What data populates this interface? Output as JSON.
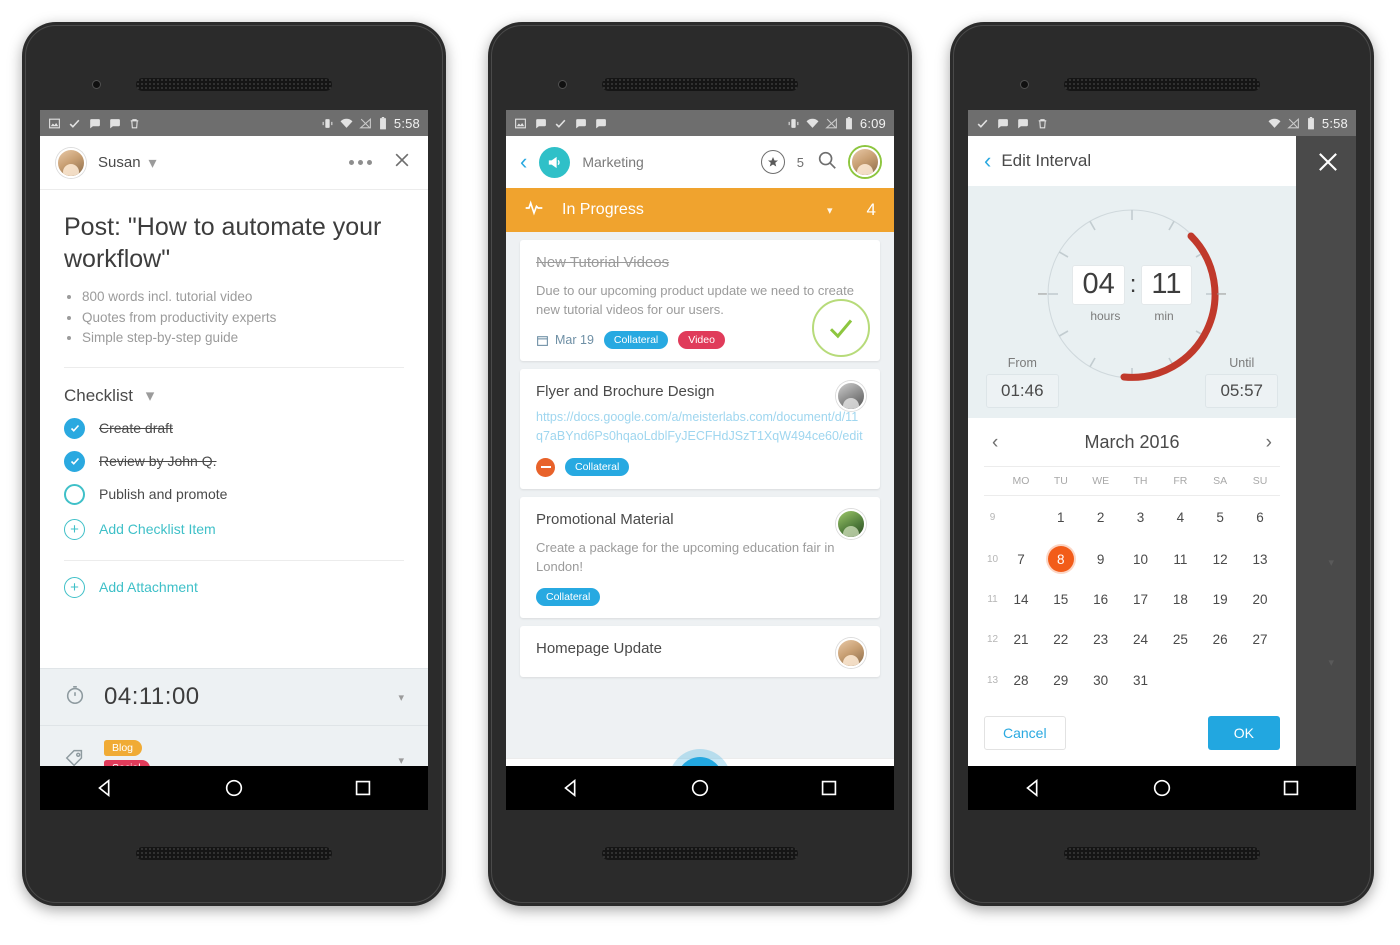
{
  "phone1": {
    "statusbar": {
      "time": "5:58",
      "left_icons": [
        "image-icon",
        "check-icon",
        "chat-icon",
        "chat-icon",
        "trash-icon"
      ],
      "right_icons": [
        "vibrate-icon",
        "wifi-icon",
        "signal-off-icon",
        "battery-icon"
      ]
    },
    "header": {
      "user": "Susan",
      "caret": "▾",
      "more_label": "more-options",
      "close_label": "✕"
    },
    "title": "Post: \"How to automate your workflow\"",
    "bullets": [
      "800 words incl. tutorial video",
      "Quotes from productivity experts",
      "Simple step-by-step guide"
    ],
    "checklist": {
      "section_label": "Checklist",
      "caret": "▾",
      "items": [
        {
          "label": "Create draft",
          "checked": true
        },
        {
          "label": "Review by John Q.",
          "checked": true
        },
        {
          "label": "Publish and promote",
          "checked": false
        }
      ],
      "add_label": "Add Checklist Item",
      "plus": "+"
    },
    "attachment": {
      "add_label": "Add Attachment",
      "plus": "+"
    },
    "timer": {
      "value": "04:11:00",
      "caret": "▾"
    },
    "tags": {
      "items": [
        "Blog",
        "Social"
      ],
      "caret": "▾"
    }
  },
  "phone2": {
    "statusbar": {
      "time": "6:09",
      "left_icons": [
        "image-icon",
        "chat-icon",
        "check-icon",
        "chat-icon",
        "chat-icon"
      ],
      "right_icons": [
        "vibrate-icon",
        "wifi-icon",
        "signal-off-icon",
        "battery-icon"
      ]
    },
    "header": {
      "back": "‹",
      "project": "Marketing",
      "star_count": "5"
    },
    "section": {
      "name": "In Progress",
      "caret": "▾",
      "count": "4"
    },
    "cards": [
      {
        "title": "New Tutorial Videos",
        "done": true,
        "desc": "Due to our upcoming product update we need to create new tutorial videos for our users.",
        "due": "Mar 19",
        "pills": [
          {
            "label": "Collateral",
            "kind": "collateral"
          },
          {
            "label": "Video",
            "kind": "video"
          }
        ],
        "has_bigcheck": true
      },
      {
        "title": "Flyer and Brochure Design",
        "done": false,
        "link": "https://docs.google.com/a/meisterlabs.com/document/d/11q7aBYnd6Ps0hqaoLdblFyJECFHdJSzT1XqW494ce60/edit",
        "pills": [
          {
            "label": "Collateral",
            "kind": "collateral"
          }
        ],
        "has_stop": true
      },
      {
        "title": "Promotional Material",
        "done": false,
        "desc": "Create a package for the upcoming education fair in London!",
        "pills": [
          {
            "label": "Collateral",
            "kind": "collateral"
          }
        ]
      },
      {
        "title": "Homepage Update",
        "done": false
      }
    ],
    "tabbar": {
      "items": [
        "activity-icon",
        "add-fab",
        "person-icon"
      ],
      "fab_label": "+"
    }
  },
  "phone3": {
    "statusbar": {
      "time": "5:58",
      "left_icons": [
        "check-icon",
        "chat-icon",
        "chat-icon",
        "trash-icon"
      ],
      "right_icons": [
        "wifi-icon",
        "signal-off-icon",
        "battery-icon"
      ]
    },
    "header": {
      "back": "‹",
      "title": "Edit Interval",
      "close": "✕"
    },
    "dial": {
      "hours": "04",
      "minutes": "11",
      "colon": ":",
      "hours_label": "hours",
      "minutes_label": "min",
      "minus_left": "–",
      "minus_right": "–"
    },
    "range": {
      "from_label": "From",
      "from_value": "01:46",
      "until_label": "Until",
      "until_value": "05:57"
    },
    "calendar": {
      "month": "March 2016",
      "prev": "‹",
      "next": "›",
      "weekdays": [
        "MO",
        "TU",
        "WE",
        "TH",
        "FR",
        "SA",
        "SU"
      ],
      "weeks": [
        {
          "wk": "9",
          "days": [
            "",
            "1",
            "2",
            "3",
            "4",
            "5",
            "6"
          ]
        },
        {
          "wk": "10",
          "days": [
            "7",
            "8",
            "9",
            "10",
            "11",
            "12",
            "13"
          ]
        },
        {
          "wk": "11",
          "days": [
            "14",
            "15",
            "16",
            "17",
            "18",
            "19",
            "20"
          ]
        },
        {
          "wk": "12",
          "days": [
            "21",
            "22",
            "23",
            "24",
            "25",
            "26",
            "27"
          ]
        },
        {
          "wk": "13",
          "days": [
            "28",
            "29",
            "30",
            "31",
            "",
            "",
            ""
          ]
        }
      ],
      "selected": "8"
    },
    "actions": {
      "cancel": "Cancel",
      "ok": "OK"
    }
  },
  "colors": {
    "accent_blue": "#22a7e0",
    "teal": "#3fc0c8",
    "orange_section": "#f0a32e",
    "tag_blog": "#f0ab35",
    "tag_social": "#e03b5a",
    "pill_collateral": "#27a9e1",
    "pill_video": "#e03b5a",
    "selected_day": "#f25c19",
    "dial_arc": "#c0392b",
    "statusbar": "#6e6e6e"
  }
}
